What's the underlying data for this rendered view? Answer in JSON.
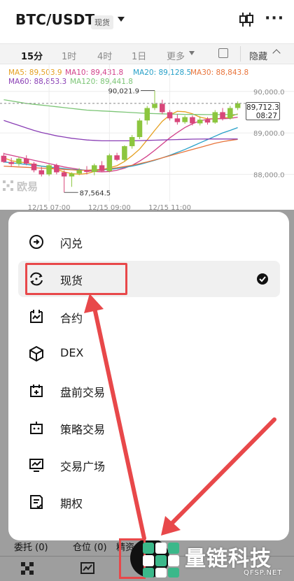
{
  "header": {
    "pair": "BTC/USDT",
    "badge": "现货",
    "more": "···"
  },
  "timeframes": [
    {
      "label": "15分",
      "active": true
    },
    {
      "label": "1时",
      "active": false
    },
    {
      "label": "4时",
      "active": false
    },
    {
      "label": "1日",
      "active": false
    },
    {
      "label": "更多",
      "active": false
    },
    {
      "label": "隐藏",
      "active": false
    }
  ],
  "ma_legend": {
    "ma5": "MA5: 89,503.9",
    "ma10": "MA10: 89,431.8",
    "ma20": "MA20: 89,128.5",
    "ma30": "MA30: 88,843.8",
    "ma60": "MA60: 88,853.3",
    "ma120": "MA120: 89,441.8"
  },
  "colors": {
    "up": "#8cc63f",
    "down": "#d8467a",
    "ma5": "#e5a020",
    "ma10": "#d2418a",
    "ma20": "#27a0c8",
    "ma30": "#e8743b",
    "ma60": "#8a3fb5",
    "ma120": "#7cc576",
    "accent_red": "#e8484a"
  },
  "price_tag": {
    "price": "89,712.3",
    "countdown": "08:27"
  },
  "watermark": "欧易",
  "chart_data": {
    "type": "candlestick",
    "y_ticks": [
      "90,000.0",
      "89,000.0",
      "88,000.0"
    ],
    "y_tick_values": [
      90000,
      89000,
      88000
    ],
    "ylim": [
      87350,
      90350
    ],
    "x_ticks": [
      "12/15 07:00",
      "12/15 09:00",
      "12/15 11:00"
    ],
    "x_tick_index": [
      6,
      14,
      22
    ],
    "high_label": "90,021.9",
    "low_label": "87,564.5",
    "candles": [
      {
        "o": 88450,
        "h": 88520,
        "l": 88280,
        "c": 88300
      },
      {
        "o": 88300,
        "h": 88400,
        "l": 88180,
        "c": 88250
      },
      {
        "o": 88260,
        "h": 88420,
        "l": 88200,
        "c": 88380
      },
      {
        "o": 88380,
        "h": 88460,
        "l": 88220,
        "c": 88260
      },
      {
        "o": 88260,
        "h": 88300,
        "l": 88050,
        "c": 88100
      },
      {
        "o": 88100,
        "h": 88180,
        "l": 87950,
        "c": 88000
      },
      {
        "o": 88000,
        "h": 88250,
        "l": 87960,
        "c": 88220
      },
      {
        "o": 88220,
        "h": 88260,
        "l": 88000,
        "c": 88050
      },
      {
        "o": 88050,
        "h": 88100,
        "l": 87564.5,
        "c": 87950
      },
      {
        "o": 87950,
        "h": 88050,
        "l": 87700,
        "c": 88020
      },
      {
        "o": 88020,
        "h": 88150,
        "l": 87980,
        "c": 88100
      },
      {
        "o": 88100,
        "h": 88200,
        "l": 88000,
        "c": 88060
      },
      {
        "o": 88060,
        "h": 88260,
        "l": 87980,
        "c": 88220
      },
      {
        "o": 88220,
        "h": 88320,
        "l": 88050,
        "c": 88080
      },
      {
        "o": 88080,
        "h": 88500,
        "l": 88050,
        "c": 88460
      },
      {
        "o": 88460,
        "h": 88520,
        "l": 88320,
        "c": 88350
      },
      {
        "o": 88350,
        "h": 88700,
        "l": 88320,
        "c": 88680
      },
      {
        "o": 88680,
        "h": 88950,
        "l": 88620,
        "c": 88900
      },
      {
        "o": 88900,
        "h": 89350,
        "l": 88850,
        "c": 89300
      },
      {
        "o": 89300,
        "h": 89650,
        "l": 89200,
        "c": 89600
      },
      {
        "o": 89600,
        "h": 90021.9,
        "l": 89550,
        "c": 89700
      },
      {
        "o": 89700,
        "h": 89800,
        "l": 89450,
        "c": 89500
      },
      {
        "o": 89500,
        "h": 89550,
        "l": 89300,
        "c": 89350
      },
      {
        "o": 89350,
        "h": 89450,
        "l": 89200,
        "c": 89260
      },
      {
        "o": 89260,
        "h": 89420,
        "l": 89220,
        "c": 89380
      },
      {
        "o": 89380,
        "h": 89420,
        "l": 89180,
        "c": 89230
      },
      {
        "o": 89230,
        "h": 89400,
        "l": 89180,
        "c": 89320
      },
      {
        "o": 89320,
        "h": 89380,
        "l": 89200,
        "c": 89250
      },
      {
        "o": 89250,
        "h": 89550,
        "l": 89220,
        "c": 89500
      },
      {
        "o": 89500,
        "h": 89600,
        "l": 89300,
        "c": 89350
      },
      {
        "o": 89350,
        "h": 89650,
        "l": 89320,
        "c": 89600
      },
      {
        "o": 89600,
        "h": 89760,
        "l": 89550,
        "c": 89712.3
      }
    ],
    "ma_lines": [
      {
        "name": "MA5",
        "color": "#e5a020",
        "values": [
          88400,
          88330,
          88300,
          88280,
          88240,
          88200,
          88170,
          88120,
          88060,
          88020,
          88000,
          88020,
          88070,
          88110,
          88160,
          88210,
          88310,
          88450,
          88610,
          88830,
          89060,
          89280,
          89430,
          89520,
          89510,
          89460,
          89380,
          89340,
          89340,
          89350,
          89390,
          89460
        ]
      },
      {
        "name": "MA10",
        "color": "#d2418a",
        "values": [
          88500,
          88460,
          88420,
          88380,
          88340,
          88300,
          88260,
          88220,
          88180,
          88150,
          88120,
          88090,
          88070,
          88060,
          88070,
          88100,
          88150,
          88220,
          88320,
          88440,
          88580,
          88730,
          88880,
          89010,
          89130,
          89220,
          89290,
          89330,
          89340,
          89340,
          89350,
          89380
        ]
      },
      {
        "name": "MA20",
        "color": "#27a0c8",
        "values": [
          88300,
          88280,
          88260,
          88240,
          88220,
          88200,
          88180,
          88160,
          88140,
          88120,
          88110,
          88100,
          88100,
          88110,
          88120,
          88140,
          88170,
          88200,
          88240,
          88290,
          88340,
          88400,
          88460,
          88530,
          88600,
          88680,
          88760,
          88840,
          88920,
          89000,
          89060,
          89128.5
        ]
      },
      {
        "name": "MA30",
        "color": "#e8743b",
        "values": [
          88200,
          88190,
          88180,
          88170,
          88160,
          88150,
          88140,
          88130,
          88120,
          88110,
          88100,
          88100,
          88110,
          88120,
          88140,
          88160,
          88190,
          88220,
          88260,
          88300,
          88350,
          88400,
          88450,
          88500,
          88550,
          88600,
          88650,
          88700,
          88750,
          88790,
          88820,
          88843.8
        ]
      },
      {
        "name": "MA60",
        "color": "#8a3fb5",
        "values": [
          89300,
          89240,
          89180,
          89120,
          89060,
          89010,
          88970,
          88930,
          88900,
          88870,
          88850,
          88830,
          88820,
          88810,
          88810,
          88810,
          88810,
          88810,
          88815,
          88820,
          88825,
          88830,
          88835,
          88840,
          88845,
          88850,
          88852,
          88853,
          88853,
          88853,
          88853,
          88853.3
        ]
      },
      {
        "name": "MA120",
        "color": "#7cc576",
        "values": [
          89800,
          89770,
          89740,
          89710,
          89690,
          89670,
          89650,
          89630,
          89610,
          89590,
          89570,
          89550,
          89540,
          89530,
          89520,
          89510,
          89500,
          89490,
          89480,
          89470,
          89465,
          89460,
          89455,
          89450,
          89447,
          89445,
          89443,
          89442,
          89442,
          89442,
          89442,
          89441.8
        ]
      }
    ]
  },
  "menu": {
    "items": [
      {
        "label": "闪兑",
        "icon": "swap-icon",
        "selected": false
      },
      {
        "label": "现货",
        "icon": "spot-icon",
        "selected": true
      },
      {
        "label": "合约",
        "icon": "futures-icon",
        "selected": false
      },
      {
        "label": "DEX",
        "icon": "dex-cube-icon",
        "selected": false
      },
      {
        "label": "盘前交易",
        "icon": "pre-market-icon",
        "selected": false
      },
      {
        "label": "策略交易",
        "icon": "strategy-bot-icon",
        "selected": false
      },
      {
        "label": "交易广场",
        "icon": "trading-square-icon",
        "selected": false
      },
      {
        "label": "期权",
        "icon": "options-icon",
        "selected": false
      }
    ]
  },
  "order_bar": {
    "orders": "委托 (0)",
    "positions": "仓位 (0)",
    "assets": "精资"
  },
  "brand": {
    "name": "量链科技",
    "site": "QFSP.NET"
  }
}
